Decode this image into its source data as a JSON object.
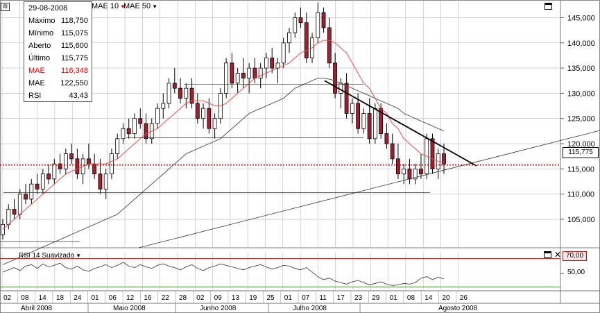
{
  "tooltip": {
    "date": "29-08-2008",
    "rows": [
      {
        "label": "Máximo",
        "value": "118,750",
        "color": "#000000"
      },
      {
        "label": "Mínimo",
        "value": "115,075",
        "color": "#000000"
      },
      {
        "label": "Aberto",
        "value": "115,600",
        "color": "#000000"
      },
      {
        "label": "Último",
        "value": "115,775",
        "color": "#000000"
      },
      {
        "label": "MAE",
        "value": "116,348",
        "color": "#e00000"
      },
      {
        "label": "MAE",
        "value": "122,550",
        "color": "#000000"
      },
      {
        "label": "RSI",
        "value": "43,43",
        "color": "#000000"
      }
    ]
  },
  "indicators": {
    "mae10": "MAE 10",
    "mae50": "MAE 50",
    "rsi": "RSI 14 Suavizado"
  },
  "icons": {
    "chart_menu": "chart-menu-icon",
    "maximize": "maximize-icon",
    "close": "close-icon",
    "dropdown": "dropdown-arrow-icon"
  },
  "colors": {
    "up_candle": "#ffffff",
    "down_candle": "#a02030",
    "ma10": "#e05050",
    "ma50": "#555555",
    "last_price_line": "#d00000",
    "rsi_upper": "#e00000",
    "rsi_lower": "#2ca02c",
    "grid": "#b8b8b8"
  },
  "chart_data": {
    "type": "candlestick",
    "y_ticks": [
      "145,000",
      "140,000",
      "135,000",
      "130,000",
      "125,000",
      "120,000",
      "115,000",
      "110,000",
      "105,000"
    ],
    "y_tick_values": [
      145,
      140,
      135,
      130,
      125,
      120,
      115,
      110,
      105
    ],
    "ylim": [
      99.5,
      148.5
    ],
    "last_price": "115,775",
    "last_price_value": 115.775,
    "rsi_ticks": [
      "70,00",
      "50,00"
    ],
    "rsi_tick_values": [
      70,
      50
    ],
    "rsi_ylim": [
      28,
      78
    ],
    "x_day_labels": [
      "02",
      "08",
      "14",
      "18",
      "24",
      "01",
      "06",
      "12",
      "16",
      "22",
      "28",
      "02",
      "09",
      "13",
      "19",
      "25",
      "01",
      "07",
      "11",
      "17",
      "23",
      "29",
      "01",
      "08",
      "14",
      "20",
      "26"
    ],
    "x_month_labels": [
      "Abril 2008",
      "Maio 2008",
      "Junho 2008",
      "Julho 2008",
      "Agosto 2008"
    ],
    "candles": [
      [
        102,
        105,
        101,
        104
      ],
      [
        104,
        108,
        103,
        107
      ],
      [
        107,
        109,
        105,
        106
      ],
      [
        106,
        111,
        105,
        110
      ],
      [
        110,
        112,
        108,
        109
      ],
      [
        109,
        113,
        108,
        112
      ],
      [
        112,
        114,
        110,
        111
      ],
      [
        111,
        115,
        110,
        114
      ],
      [
        114,
        116,
        112,
        113
      ],
      [
        113,
        117,
        112,
        116
      ],
      [
        116,
        118,
        114,
        115
      ],
      [
        115,
        119,
        114,
        118
      ],
      [
        118,
        120,
        116,
        117
      ],
      [
        117,
        119,
        113,
        114
      ],
      [
        114,
        118,
        112,
        117
      ],
      [
        117,
        120,
        115,
        116
      ],
      [
        116,
        118,
        113,
        114
      ],
      [
        114,
        117,
        110,
        111
      ],
      [
        111,
        115,
        109,
        114
      ],
      [
        114,
        119,
        113,
        118
      ],
      [
        118,
        122,
        117,
        121
      ],
      [
        121,
        124,
        120,
        123
      ],
      [
        123,
        125,
        121,
        122
      ],
      [
        122,
        126,
        121,
        125
      ],
      [
        125,
        127,
        123,
        124
      ],
      [
        124,
        126,
        120,
        121
      ],
      [
        121,
        125,
        120,
        124
      ],
      [
        124,
        128,
        123,
        127
      ],
      [
        127,
        130,
        125,
        128
      ],
      [
        128,
        133,
        127,
        132
      ],
      [
        132,
        135,
        130,
        131
      ],
      [
        131,
        133,
        128,
        129
      ],
      [
        129,
        132,
        127,
        131
      ],
      [
        131,
        133,
        127,
        128
      ],
      [
        128,
        130,
        124,
        125
      ],
      [
        125,
        128,
        123,
        127
      ],
      [
        127,
        129,
        122,
        123
      ],
      [
        123,
        126,
        121,
        125
      ],
      [
        125,
        131,
        124,
        130
      ],
      [
        130,
        137,
        129,
        136
      ],
      [
        136,
        138,
        131,
        132
      ],
      [
        132,
        135,
        130,
        134
      ],
      [
        134,
        137,
        131,
        133
      ],
      [
        133,
        136,
        130,
        135
      ],
      [
        135,
        137,
        132,
        133
      ],
      [
        133,
        136,
        131,
        135
      ],
      [
        135,
        138,
        133,
        137
      ],
      [
        137,
        139,
        134,
        135
      ],
      [
        135,
        137,
        132,
        136
      ],
      [
        136,
        141,
        135,
        140
      ],
      [
        140,
        143,
        138,
        142
      ],
      [
        142,
        146,
        141,
        145
      ],
      [
        145,
        147,
        143,
        144
      ],
      [
        144,
        146,
        136,
        137
      ],
      [
        137,
        142,
        136,
        141
      ],
      [
        141,
        148,
        140,
        146
      ],
      [
        146,
        147,
        142,
        143
      ],
      [
        143,
        145,
        135,
        136
      ],
      [
        136,
        138,
        129,
        130
      ],
      [
        130,
        133,
        127,
        132
      ],
      [
        132,
        134,
        125,
        126
      ],
      [
        126,
        129,
        124,
        128
      ],
      [
        128,
        130,
        122,
        123
      ],
      [
        123,
        127,
        122,
        126
      ],
      [
        126,
        129,
        120,
        121
      ],
      [
        121,
        128,
        120,
        127
      ],
      [
        127,
        128,
        121,
        122
      ],
      [
        122,
        124,
        119,
        120
      ],
      [
        120,
        122,
        116,
        117
      ],
      [
        117,
        120,
        113,
        114
      ],
      [
        114,
        116,
        112,
        115
      ],
      [
        115,
        117,
        112,
        113
      ],
      [
        113,
        116,
        112,
        115
      ],
      [
        115,
        118,
        113,
        114
      ],
      [
        114,
        122,
        113,
        121
      ],
      [
        121,
        122,
        114,
        115
      ],
      [
        115,
        119,
        113,
        118
      ],
      [
        118,
        120,
        114,
        116
      ]
    ],
    "ma10": [
      103,
      104,
      105,
      106,
      107,
      108,
      109,
      110,
      111,
      112,
      113,
      114,
      114.5,
      115,
      115.5,
      116,
      116,
      116,
      116,
      116.5,
      117,
      118,
      119,
      120,
      121,
      122,
      122.5,
      123,
      124,
      125,
      126,
      127,
      128,
      128.5,
      128.5,
      128.5,
      128,
      127.5,
      127.5,
      128,
      129,
      130,
      131,
      132,
      133,
      133.5,
      134,
      134.5,
      135,
      135.5,
      136,
      137,
      138,
      138.5,
      139,
      140,
      140.5,
      140.5,
      140,
      139,
      138,
      136,
      134,
      132,
      131,
      129,
      127,
      126,
      124,
      123,
      121,
      120,
      119,
      118,
      117.5,
      117,
      116.5,
      116.3
    ],
    "ma50": [
      96,
      96.5,
      97,
      97.5,
      98,
      98.5,
      99,
      99.5,
      100,
      100.5,
      101,
      101.5,
      102,
      102.5,
      103,
      103.5,
      104,
      104.5,
      105,
      105.5,
      106,
      107,
      108,
      109,
      110,
      111,
      112,
      113,
      114,
      115,
      116,
      117,
      118,
      118.5,
      119,
      119.5,
      120,
      120.5,
      121,
      122,
      123,
      124,
      125,
      126,
      126.5,
      127,
      127.5,
      128,
      128.5,
      129,
      130,
      131,
      131.5,
      132,
      132.5,
      133,
      133,
      132.8,
      132.5,
      132,
      131.5,
      131,
      130.5,
      130,
      129.5,
      129,
      128.5,
      128,
      127.5,
      127,
      126,
      125.5,
      125,
      124.5,
      124,
      123.5,
      123,
      122.55
    ],
    "rsi": [
      52,
      55,
      58,
      54,
      60,
      62,
      57,
      63,
      59,
      61,
      64,
      58,
      56,
      60,
      55,
      53,
      57,
      59,
      62,
      58,
      61,
      65,
      60,
      58,
      62,
      59,
      57,
      61,
      63,
      60,
      58,
      55,
      59,
      62,
      57,
      54,
      58,
      60,
      63,
      61,
      59,
      57,
      55,
      58,
      60,
      62,
      59,
      56,
      58,
      61,
      60,
      57,
      55,
      58,
      52,
      46,
      42,
      44,
      40,
      38,
      36,
      39,
      41,
      38,
      35,
      37,
      39,
      36,
      34,
      35,
      37,
      36,
      38,
      44,
      46,
      42,
      45,
      43
    ]
  }
}
